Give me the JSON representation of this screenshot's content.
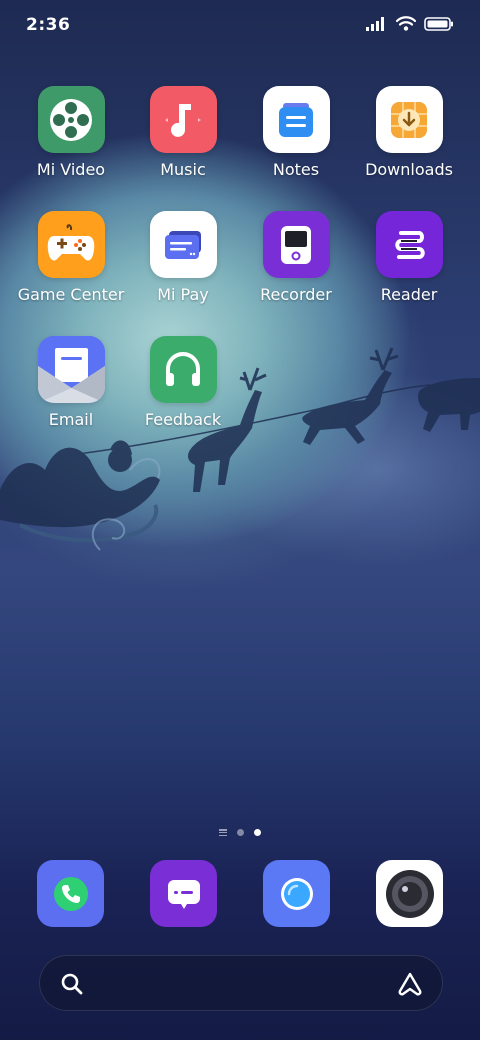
{
  "status_bar": {
    "time": "2:36",
    "icons": [
      "signal-icon",
      "wifi-icon",
      "battery-icon"
    ]
  },
  "apps": [
    {
      "label": "Mi Video",
      "icon": "mi-video-icon",
      "color": "#3f9a6a"
    },
    {
      "label": "Music",
      "icon": "music-icon",
      "color": "#f25a66"
    },
    {
      "label": "Notes",
      "icon": "notes-icon",
      "color": "#ffffff"
    },
    {
      "label": "Downloads",
      "icon": "downloads-icon",
      "color": "#ffffff"
    },
    {
      "label": "Game Center",
      "icon": "game-center-icon",
      "color": "#ff9f1c"
    },
    {
      "label": "Mi Pay",
      "icon": "mi-pay-icon",
      "color": "#ffffff"
    },
    {
      "label": "Recorder",
      "icon": "recorder-icon",
      "color": "#7a2fd6"
    },
    {
      "label": "Reader",
      "icon": "reader-icon",
      "color": "#7526d8"
    },
    {
      "label": "Email",
      "icon": "email-icon",
      "color": "#5b72f5"
    },
    {
      "label": "Feedback",
      "icon": "feedback-icon",
      "color": "#3cac6c"
    }
  ],
  "page_indicator": {
    "pages": 2,
    "active": 2
  },
  "dock": [
    {
      "icon": "phone-icon",
      "color": "#5b6ff0"
    },
    {
      "icon": "messages-icon",
      "color": "#7a2fd6"
    },
    {
      "icon": "browser-icon",
      "color": "#5b78f5"
    },
    {
      "icon": "camera-icon",
      "color": "#ffffff"
    }
  ],
  "search": {
    "icon": "search-icon",
    "assistant": "assistant-icon"
  }
}
